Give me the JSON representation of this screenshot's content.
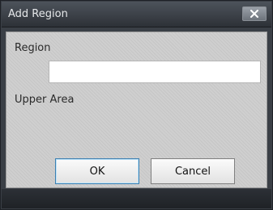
{
  "dialog": {
    "title": "Add Region",
    "close_icon": "close-icon"
  },
  "form": {
    "region_label": "Region",
    "region_value": "",
    "region_placeholder": "",
    "upper_area_label": "Upper Area"
  },
  "buttons": {
    "ok_label": "OK",
    "cancel_label": "Cancel"
  },
  "colors": {
    "titlebar": "#3a3f46",
    "client_background": "#cfcfcf",
    "default_button_border": "#3c7fb1"
  }
}
